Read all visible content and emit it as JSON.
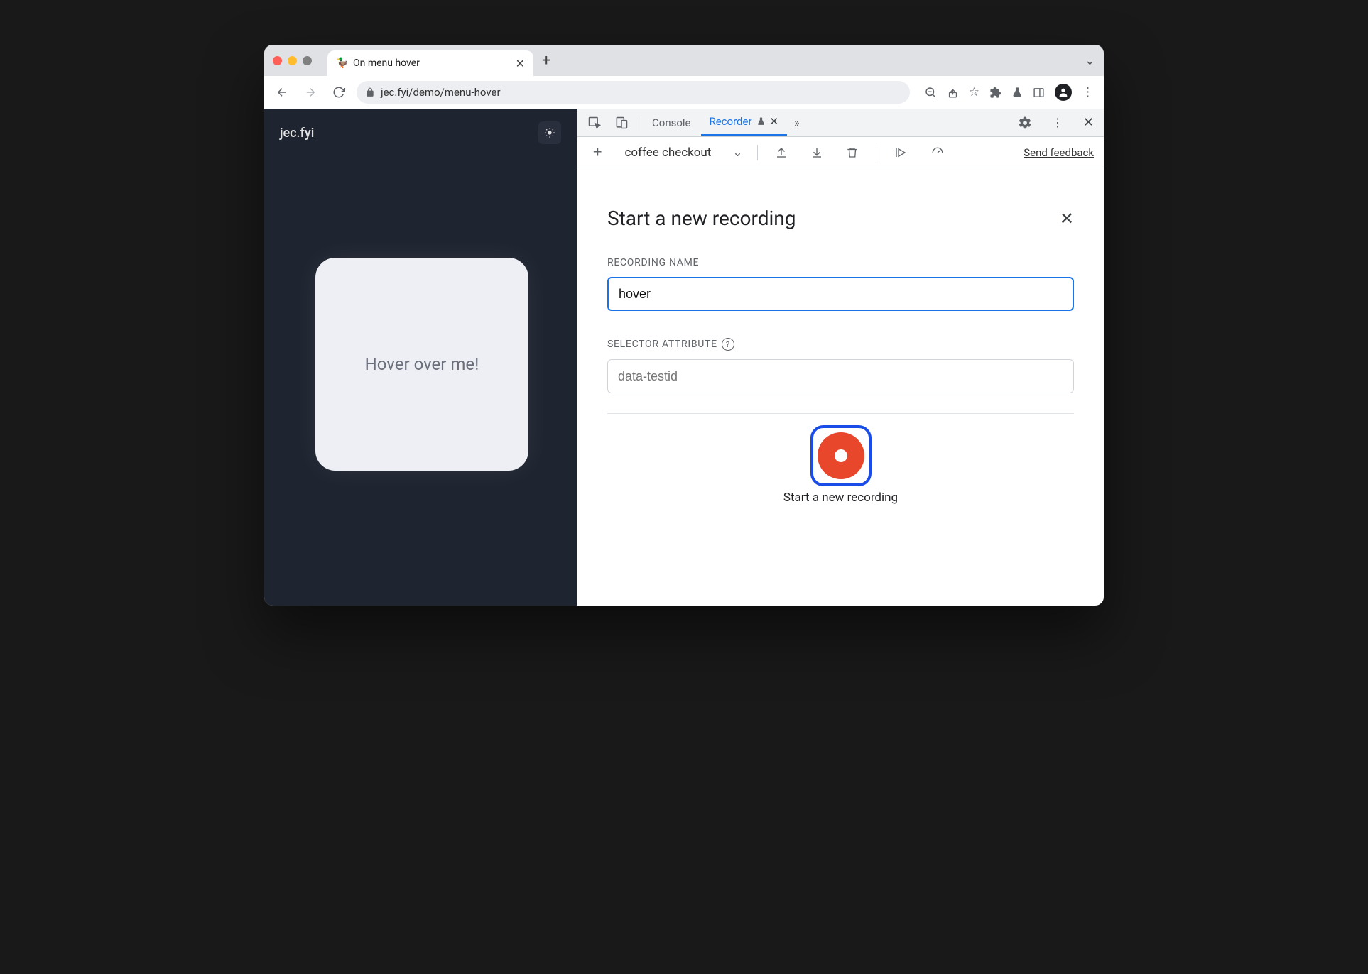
{
  "window": {
    "tab_title": "On menu hover",
    "url": "jec.fyi/demo/menu-hover"
  },
  "page": {
    "brand": "jec.fyi",
    "card_text": "Hover over me!"
  },
  "devtools": {
    "tabs": {
      "console": "Console",
      "recorder": "Recorder"
    },
    "toolbar": {
      "recording_select": "coffee checkout",
      "feedback": "Send feedback"
    },
    "recorder": {
      "title": "Start a new recording",
      "name_label": "RECORDING NAME",
      "name_value": "hover",
      "selector_label": "SELECTOR ATTRIBUTE",
      "selector_placeholder": "data-testid",
      "start_label": "Start a new recording"
    }
  }
}
